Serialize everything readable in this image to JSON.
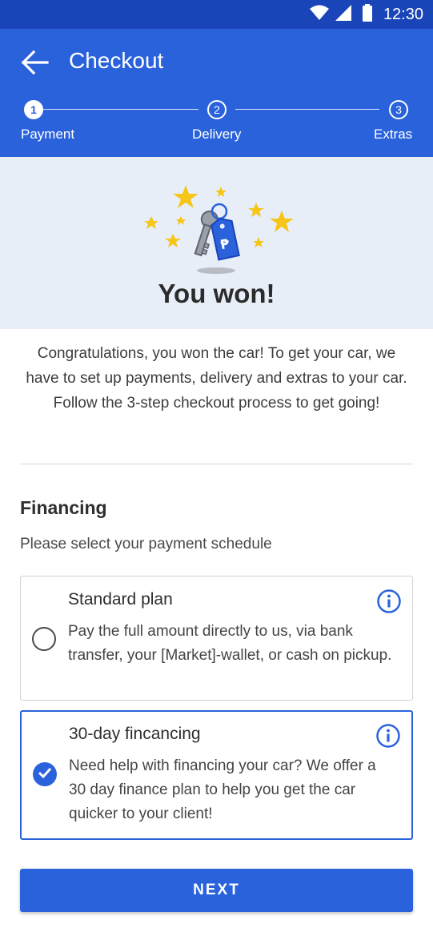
{
  "status_bar": {
    "time": "12:30",
    "icons": [
      "wifi-icon",
      "signal-icon",
      "battery-icon"
    ]
  },
  "app_bar": {
    "title": "Checkout",
    "back_icon": "arrow-left-icon"
  },
  "stepper": {
    "steps": [
      {
        "number": "1",
        "label": "Payment",
        "active": true
      },
      {
        "number": "2",
        "label": "Delivery",
        "active": false
      },
      {
        "number": "3",
        "label": "Extras",
        "active": false
      }
    ]
  },
  "hero": {
    "title": "You won!",
    "illustration": "car-keys-stars-illustration"
  },
  "intro": {
    "text": "Congratulations, you won the car! To get your car, we have to set up payments, delivery and extras to your car. Follow the 3-step checkout process to get going!"
  },
  "financing": {
    "title": "Financing",
    "subtitle": "Please select your payment schedule",
    "options": [
      {
        "title": "Standard plan",
        "description": "Pay the full amount directly to us, via bank transfer, your [Market]-wallet, or cash on pickup.",
        "selected": false
      },
      {
        "title": "30-day fincancing",
        "description": "Need help with financing your car? We offer a 30 day finance plan to help you get the car quicker to your client!",
        "selected": true
      }
    ]
  },
  "next_button": {
    "label": "NEXT"
  },
  "colors": {
    "primary": "#2a62dc",
    "status_bar": "#1a45b8",
    "hero_bg": "#e8eef8",
    "star": "#f5c518",
    "tag": "#2a62dc"
  }
}
